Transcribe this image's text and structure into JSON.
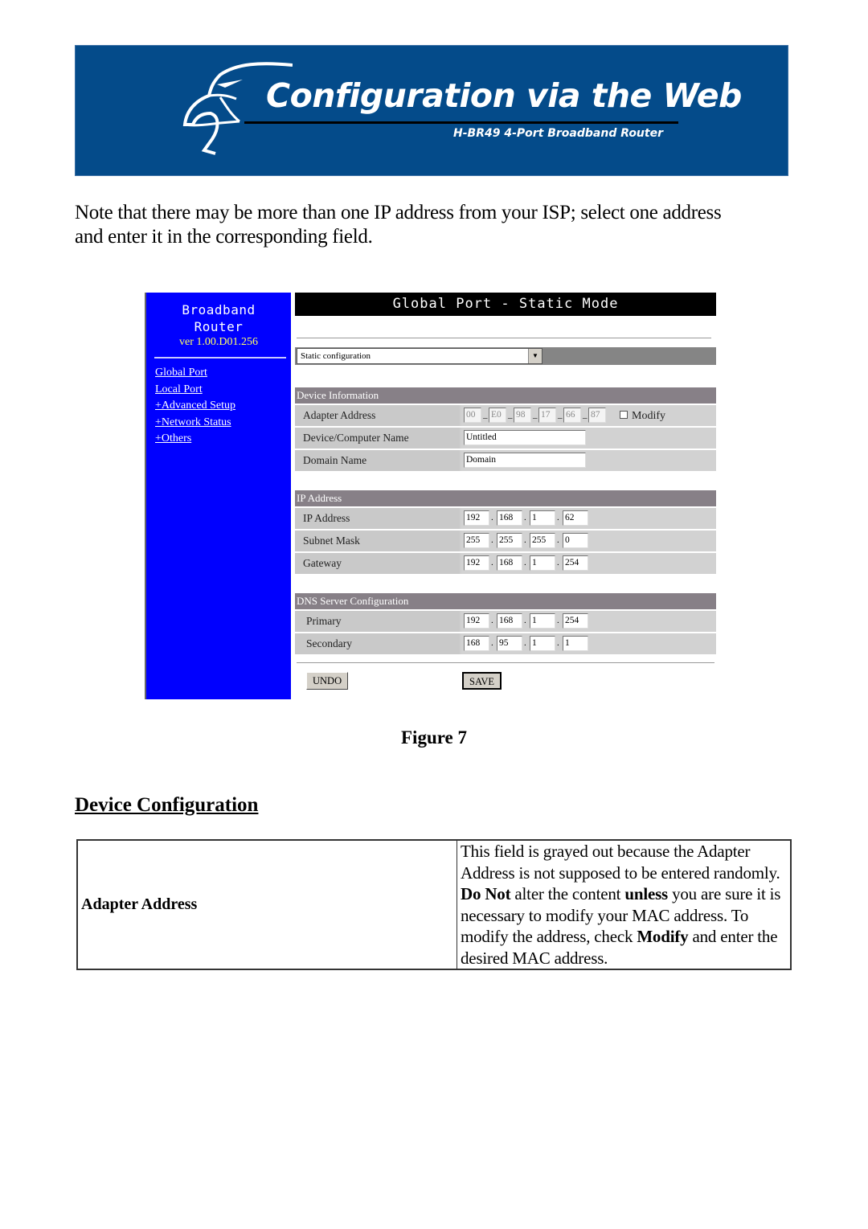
{
  "banner": {
    "title": "Configuration via the Web",
    "subtitle": "H-BR49 4-Port Broadband Router",
    "colors": {
      "background": "#044b8a",
      "text": "#ffffff"
    },
    "logo_icon": "eagle-head-icon"
  },
  "intro": "Note that there may be more than one IP address from your ISP; select one address and enter it in the corresponding field.",
  "router_ui": {
    "sidebar": {
      "brand_line1": "Broadband",
      "brand_line2": "Router",
      "version": "ver 1.00.D01.256",
      "links": [
        {
          "label": "Global Port"
        },
        {
          "label": "Local Port"
        },
        {
          "label": "+Advanced Setup"
        },
        {
          "label": "+Network Status"
        },
        {
          "label": "+Others"
        }
      ],
      "colors": {
        "background": "#0000ff",
        "version": "#ffff66"
      }
    },
    "page_title": "Global Port - Static Mode",
    "mode_select": {
      "selected": "Static configuration"
    },
    "device_info": {
      "header": "Device Information",
      "adapter_address": {
        "label": "Adapter Address",
        "octets": [
          "00",
          "E0",
          "98",
          "17",
          "66",
          "87"
        ],
        "modify_label": "Modify",
        "modify_checked": false
      },
      "device_name": {
        "label": "Device/Computer Name",
        "value": "Untitled"
      },
      "domain_name": {
        "label": "Domain Name",
        "value": "Domain"
      }
    },
    "ip_address": {
      "header": "IP Address",
      "ip": {
        "label": "IP Address",
        "octets": [
          "192",
          "168",
          "1",
          "62"
        ]
      },
      "subnet": {
        "label": "Subnet Mask",
        "octets": [
          "255",
          "255",
          "255",
          "0"
        ]
      },
      "gateway": {
        "label": "Gateway",
        "octets": [
          "192",
          "168",
          "1",
          "254"
        ]
      }
    },
    "dns": {
      "header": "DNS Server Configuration",
      "primary": {
        "label": "Primary",
        "octets": [
          "192",
          "168",
          "1",
          "254"
        ]
      },
      "secondary": {
        "label": "Secondary",
        "octets": [
          "168",
          "95",
          "1",
          "1"
        ]
      }
    },
    "buttons": {
      "undo": "UNDO",
      "save": "SAVE"
    }
  },
  "figure_caption": "Figure 7",
  "section_heading": "Device Configuration",
  "desc_table": {
    "term": "Adapter Address",
    "definition_parts": [
      {
        "text": "This field is grayed out because the Adapter Address is not supposed to be entered randomly. ",
        "bold": false
      },
      {
        "text": "Do Not",
        "bold": true
      },
      {
        "text": " alter the content ",
        "bold": false
      },
      {
        "text": "unless",
        "bold": true
      },
      {
        "text": " you are sure it is necessary to modify your MAC address. To modify the address, check ",
        "bold": false
      },
      {
        "text": "Modify",
        "bold": true
      },
      {
        "text": " and enter the desired MAC address.",
        "bold": false
      }
    ]
  }
}
